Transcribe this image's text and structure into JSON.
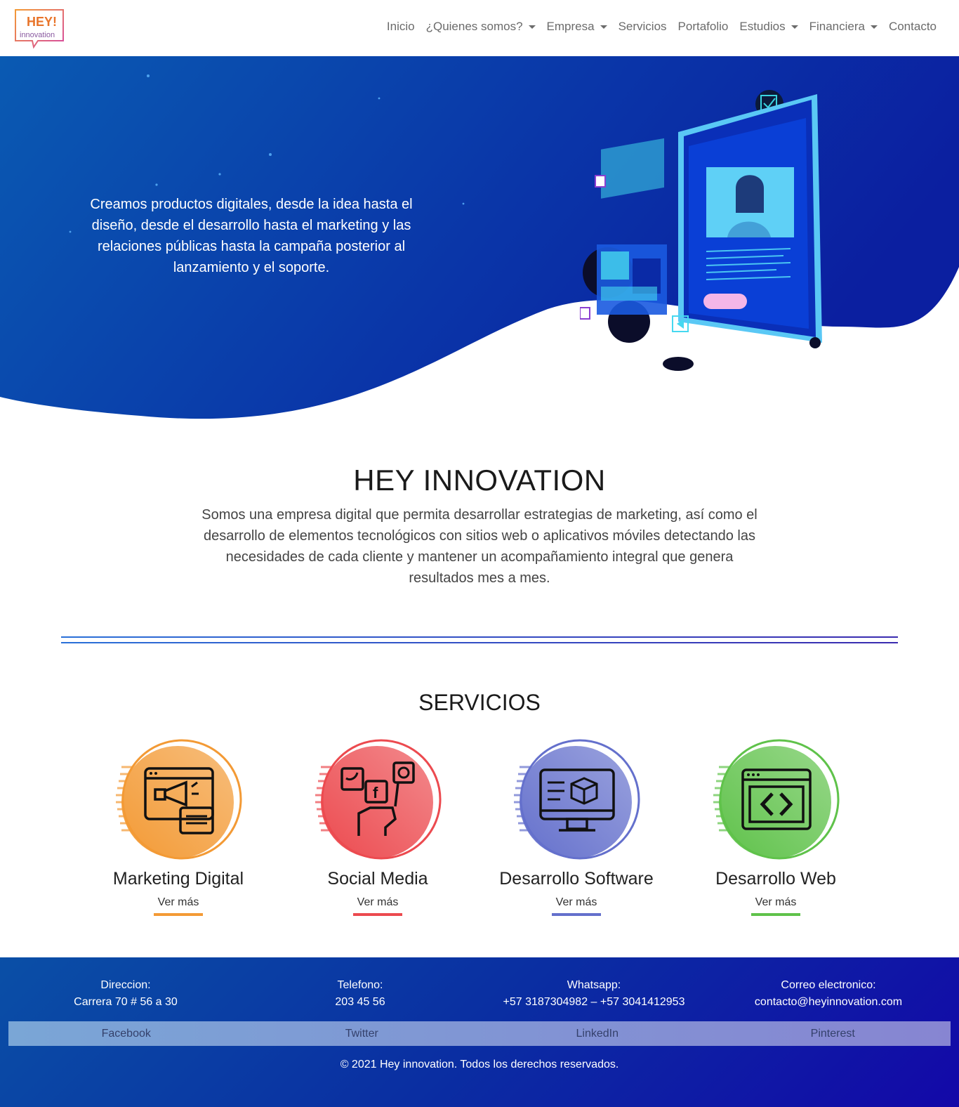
{
  "logo": {
    "line1": "HEY!",
    "line2": "innovation"
  },
  "nav": {
    "items": [
      {
        "label": "Inicio",
        "dropdown": false
      },
      {
        "label": "¿Quienes somos?",
        "dropdown": true
      },
      {
        "label": "Empresa",
        "dropdown": true
      },
      {
        "label": "Servicios",
        "dropdown": false
      },
      {
        "label": "Portafolio",
        "dropdown": false
      },
      {
        "label": "Estudios",
        "dropdown": true
      },
      {
        "label": "Financiera",
        "dropdown": true
      },
      {
        "label": "Contacto",
        "dropdown": false
      }
    ]
  },
  "hero": {
    "text": "Creamos productos digitales, desde la idea hasta el diseño, desde el desarrollo hasta el marketing y las relaciones públicas hasta la campaña posterior al lanzamiento y el soporte."
  },
  "about": {
    "title": "HEY INNOVATION",
    "text": "Somos una empresa digital que permita desarrollar estrategias de marketing, así como el desarrollo de elementos tecnológicos con sitios web o aplicativos móviles detectando las necesidades de cada cliente y mantener un acompañamiento integral que genera resultados mes a mes."
  },
  "services": {
    "title": "SERVICIOS",
    "items": [
      {
        "name": "Marketing Digital",
        "link": "Ver más",
        "color": "#f39a35",
        "icon": "megaphone-icon"
      },
      {
        "name": "Social Media",
        "link": "Ver más",
        "color": "#ec4a4f",
        "icon": "social-media-icon"
      },
      {
        "name": "Desarrollo Software",
        "link": "Ver más",
        "color": "#6470cc",
        "icon": "software-monitor-icon"
      },
      {
        "name": "Desarrollo Web",
        "link": "Ver más",
        "color": "#5fc24a",
        "icon": "web-code-icon"
      }
    ]
  },
  "footer": {
    "info": [
      {
        "label": "Direccion:",
        "value": "Carrera 70 # 56 a 30"
      },
      {
        "label": "Telefono:",
        "value": "203 45 56"
      },
      {
        "label": "Whatsapp:",
        "value": "+57 3187304982 – +57 3041412953"
      },
      {
        "label": "Correo electronico:",
        "value": "contacto@heyinnovation.com"
      }
    ],
    "social": [
      "Facebook",
      "Twitter",
      "LinkedIn",
      "Pinterest"
    ],
    "copyright": "© 2021 Hey innovation. Todos los derechos reservados."
  },
  "colors": {
    "hero_gradient_start": "#0a5ab2",
    "hero_gradient_end": "#0b1fa0"
  }
}
